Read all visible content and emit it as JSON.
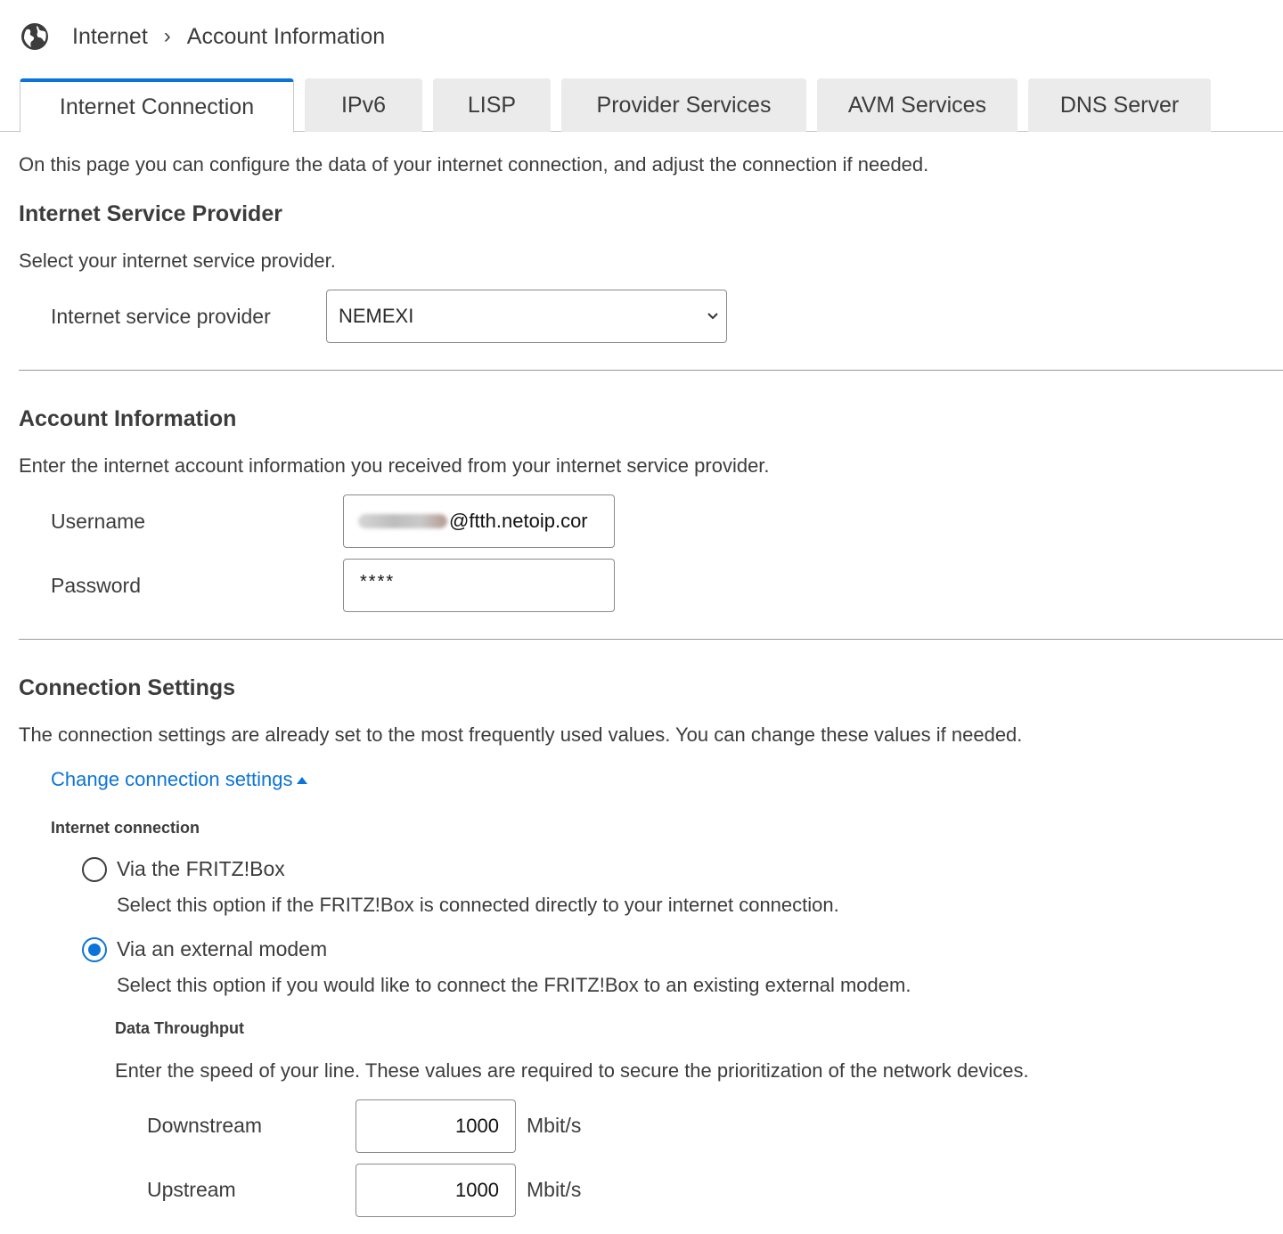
{
  "breadcrumb": {
    "root": "Internet",
    "separator": "›",
    "current": "Account Information"
  },
  "tabs": [
    "Internet Connection",
    "IPv6",
    "LISP",
    "Provider Services",
    "AVM Services",
    "DNS Server"
  ],
  "intro": "On this page you can configure the data of your internet connection, and adjust the connection if needed.",
  "isp": {
    "title": "Internet Service Provider",
    "desc": "Select your internet service provider.",
    "label": "Internet service provider",
    "value": "NEMEXI"
  },
  "account": {
    "title": "Account Information",
    "desc": "Enter the internet account information you received from your internet service provider.",
    "username_label": "Username",
    "username_value": "@ftth.netoip.cor",
    "password_label": "Password",
    "password_value": "****"
  },
  "connection": {
    "title": "Connection Settings",
    "desc": "The connection settings are already set to the most frequently used values. You can change these values if needed.",
    "toggle": "Change connection settings",
    "subtitle": "Internet connection",
    "option1_label": "Via the FRITZ!Box",
    "option1_desc": "Select this option if the FRITZ!Box is connected directly to your internet connection.",
    "option2_label": "Via an external modem",
    "option2_desc": "Select this option if you would like to connect the FRITZ!Box to an existing external modem.",
    "selected_option": "Via an external modem"
  },
  "throughput": {
    "title": "Data Throughput",
    "desc": "Enter the speed of your line. These values are required to secure the prioritization of the network devices.",
    "downstream_label": "Downstream",
    "downstream_value": "1000",
    "upstream_label": "Upstream",
    "upstream_value": "1000",
    "unit": "Mbit/s"
  },
  "colors": {
    "accent": "#0c74d8",
    "text": "#3c3c3c",
    "tab_bg": "#ebebeb"
  }
}
